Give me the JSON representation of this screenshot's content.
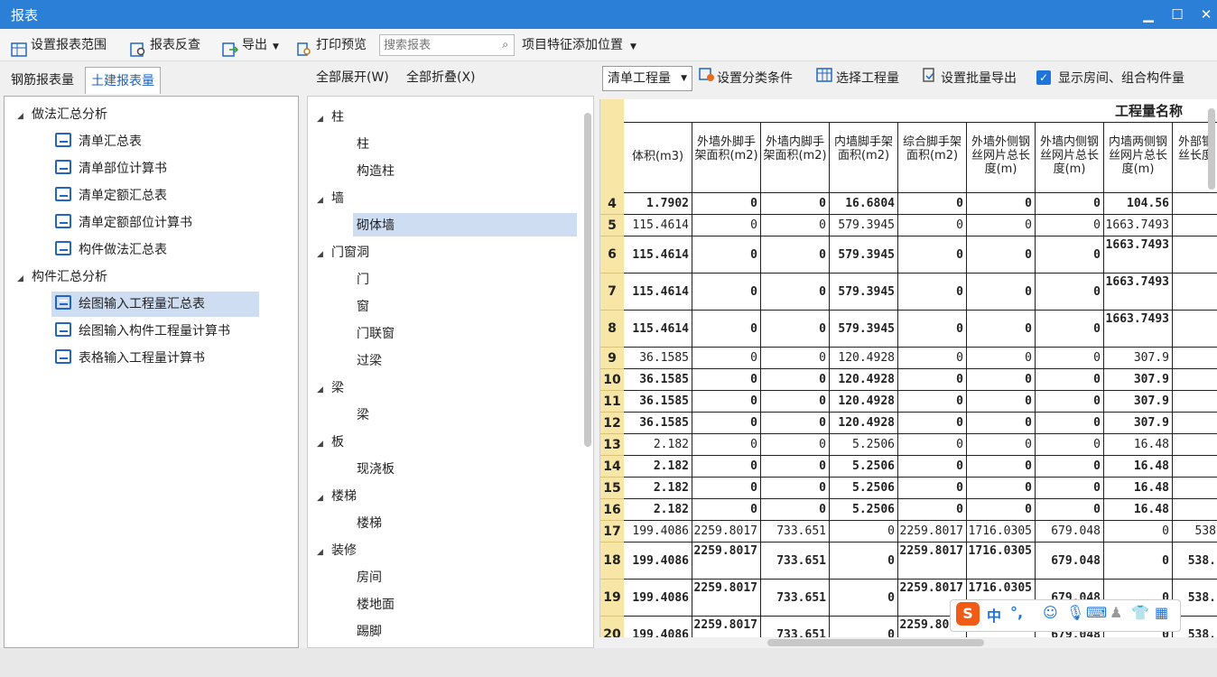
{
  "window": {
    "title": "报表"
  },
  "toolbar": {
    "set_range": "设置报表范围",
    "reverse_check": "报表反查",
    "export": "导出",
    "print_preview": "打印预览",
    "search_placeholder": "搜索报表",
    "feature_position": "项目特征添加位置"
  },
  "left_tabs": {
    "rebar": "钢筋报表量",
    "civil": "土建报表量"
  },
  "left_tree": {
    "group1": "做法汇总分析",
    "group1_items": [
      "清单汇总表",
      "清单部位计算书",
      "清单定额汇总表",
      "清单定额部位计算书",
      "构件做法汇总表"
    ],
    "group2": "构件汇总分析",
    "group2_items": [
      "绘图输入工程量汇总表",
      "绘图输入构件工程量计算书",
      "表格输入工程量计算书"
    ]
  },
  "mid_toolbar": {
    "expand_all": "全部展开(W)",
    "collapse_all": "全部折叠(X)"
  },
  "mid_tree": [
    {
      "label": "柱",
      "children": [
        "柱",
        "构造柱"
      ]
    },
    {
      "label": "墙",
      "children": [
        "砌体墙"
      ]
    },
    {
      "label": "门窗洞",
      "children": [
        "门",
        "窗",
        "门联窗",
        "过梁"
      ]
    },
    {
      "label": "梁",
      "children": [
        "梁"
      ]
    },
    {
      "label": "板",
      "children": [
        "现浇板"
      ]
    },
    {
      "label": "楼梯",
      "children": [
        "楼梯"
      ]
    },
    {
      "label": "装修",
      "children": [
        "房间",
        "楼地面",
        "踢脚"
      ]
    }
  ],
  "right_toolbar": {
    "combo_value": "清单工程量",
    "set_category": "设置分类条件",
    "select_quantity": "选择工程量",
    "batch_export": "设置批量导出",
    "show_room": "显示房间、组合构件量"
  },
  "grid": {
    "group_header": "工程量名称",
    "columns": [
      "体积(m3)",
      "外墙外脚手架面积(m2)",
      "外墙内脚手架面积(m2)",
      "内墙脚手架面积(m2)",
      "综合脚手架面积(m2)",
      "外墙外侧钢丝网片总长度(m)",
      "外墙内侧钢丝网片总长度(m)",
      "内墙两侧钢丝网片总长度(m)",
      "外部钢丝长度"
    ],
    "rows": [
      {
        "n": "4",
        "bold": true,
        "v": [
          "1.7902",
          "0",
          "0",
          "16.6804",
          "0",
          "0",
          "0",
          "104.56",
          ""
        ]
      },
      {
        "n": "5",
        "bold": false,
        "v": [
          "115.4614",
          "0",
          "0",
          "579.3945",
          "0",
          "0",
          "0",
          "1663.7493",
          ""
        ]
      },
      {
        "n": "6",
        "bold": true,
        "v": [
          "115.4614",
          "0",
          "0",
          "579.3945",
          "0",
          "0",
          "0",
          "1663.7493",
          ""
        ]
      },
      {
        "n": "7",
        "bold": true,
        "v": [
          "115.4614",
          "0",
          "0",
          "579.3945",
          "0",
          "0",
          "0",
          "1663.7493",
          ""
        ]
      },
      {
        "n": "8",
        "bold": true,
        "v": [
          "115.4614",
          "0",
          "0",
          "579.3945",
          "0",
          "0",
          "0",
          "1663.7493",
          ""
        ]
      },
      {
        "n": "9",
        "bold": false,
        "v": [
          "36.1585",
          "0",
          "0",
          "120.4928",
          "0",
          "0",
          "0",
          "307.9",
          ""
        ]
      },
      {
        "n": "10",
        "bold": true,
        "v": [
          "36.1585",
          "0",
          "0",
          "120.4928",
          "0",
          "0",
          "0",
          "307.9",
          ""
        ]
      },
      {
        "n": "11",
        "bold": true,
        "v": [
          "36.1585",
          "0",
          "0",
          "120.4928",
          "0",
          "0",
          "0",
          "307.9",
          ""
        ]
      },
      {
        "n": "12",
        "bold": true,
        "v": [
          "36.1585",
          "0",
          "0",
          "120.4928",
          "0",
          "0",
          "0",
          "307.9",
          ""
        ]
      },
      {
        "n": "13",
        "bold": false,
        "v": [
          "2.182",
          "0",
          "0",
          "5.2506",
          "0",
          "0",
          "0",
          "16.48",
          ""
        ]
      },
      {
        "n": "14",
        "bold": true,
        "v": [
          "2.182",
          "0",
          "0",
          "5.2506",
          "0",
          "0",
          "0",
          "16.48",
          ""
        ]
      },
      {
        "n": "15",
        "bold": true,
        "v": [
          "2.182",
          "0",
          "0",
          "5.2506",
          "0",
          "0",
          "0",
          "16.48",
          ""
        ]
      },
      {
        "n": "16",
        "bold": true,
        "v": [
          "2.182",
          "0",
          "0",
          "5.2506",
          "0",
          "0",
          "0",
          "16.48",
          ""
        ]
      },
      {
        "n": "17",
        "bold": false,
        "v": [
          "199.4086",
          "2259.8017",
          "733.651",
          "0",
          "2259.8017",
          "1716.0305",
          "679.048",
          "0",
          "538"
        ]
      },
      {
        "n": "18",
        "bold": true,
        "v": [
          "199.4086",
          "2259.8017",
          "733.651",
          "0",
          "2259.8017",
          "1716.0305",
          "679.048",
          "0",
          "538."
        ]
      },
      {
        "n": "19",
        "bold": true,
        "v": [
          "199.4086",
          "2259.8017",
          "733.651",
          "0",
          "2259.8017",
          "1716.0305",
          "679.048",
          "0",
          "538."
        ]
      },
      {
        "n": "20",
        "bold": true,
        "v": [
          "199.4086",
          "2259.8017",
          "733.651",
          "0",
          "2259.8017",
          "1716.0305",
          "679.048",
          "0",
          "538."
        ]
      }
    ]
  },
  "ime": {
    "lang": "中",
    "punct": "°,"
  }
}
